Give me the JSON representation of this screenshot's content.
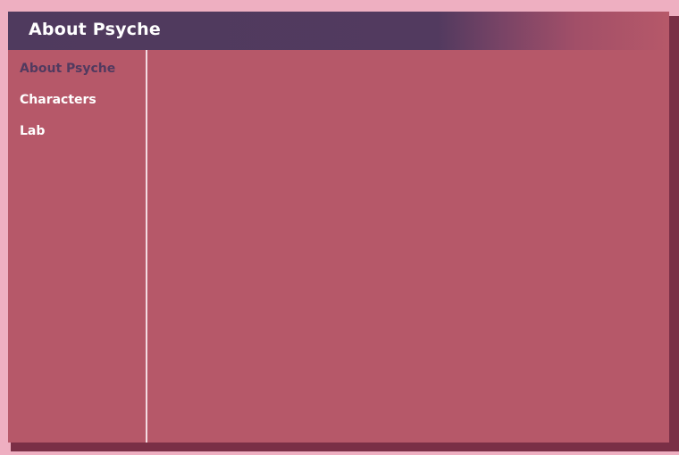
{
  "header": {
    "title": "About Psyche"
  },
  "sidebar": {
    "items": [
      {
        "label": "About Psyche",
        "active": true
      },
      {
        "label": "Characters",
        "active": false
      },
      {
        "label": "Lab",
        "active": false
      }
    ]
  },
  "colors": {
    "background": "#eeafc1",
    "panel": "#b65869",
    "header": "#4f3a5e",
    "shadow": "#7a2f46",
    "active_text": "#513a5f",
    "text": "#ffffff"
  }
}
